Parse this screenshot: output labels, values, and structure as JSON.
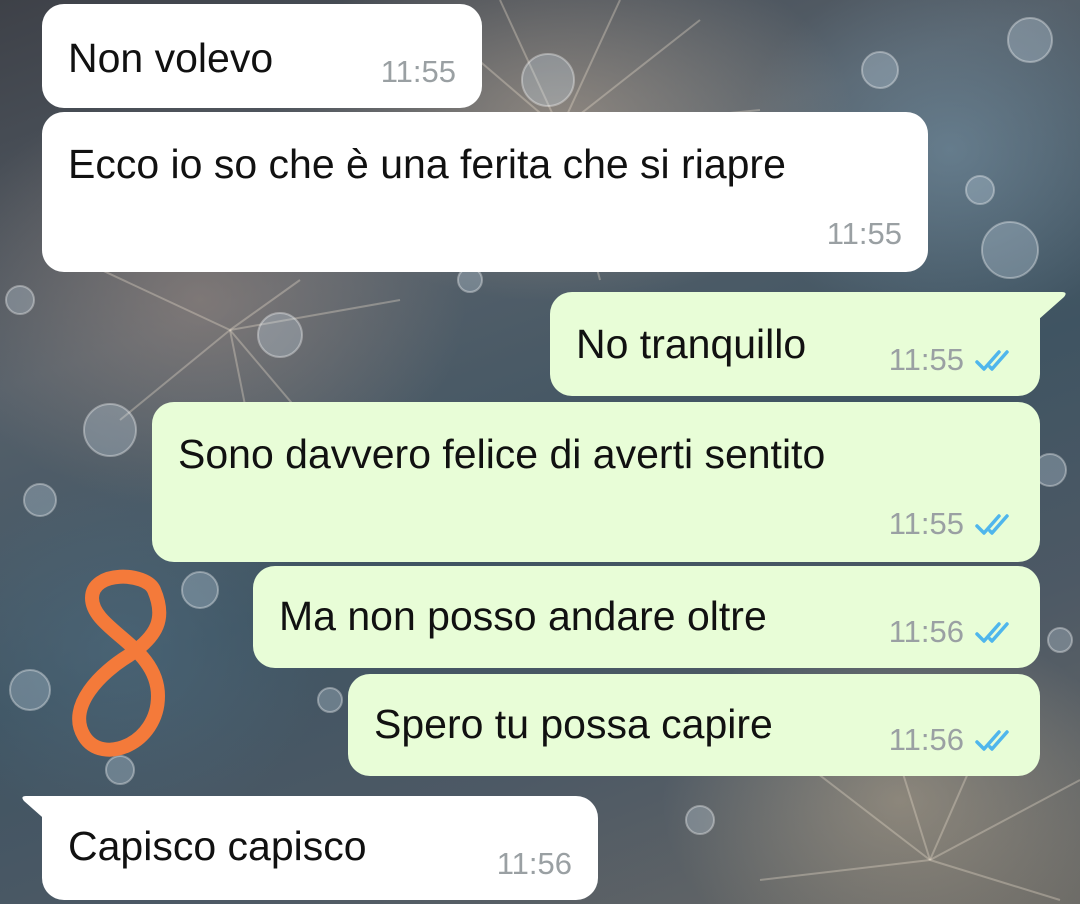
{
  "messages": [
    {
      "side": "incoming",
      "text": "Non volevo",
      "time": "11:55"
    },
    {
      "side": "incoming",
      "text": "Ecco io so che è una ferita che si riapre",
      "time": "11:55"
    },
    {
      "side": "outgoing",
      "text": "No tranquillo",
      "time": "11:55",
      "status": "double-check-read-icon"
    },
    {
      "side": "outgoing",
      "text": "Sono davvero felice di averti sentito",
      "time": "11:55",
      "status": "double-check-read-icon"
    },
    {
      "side": "outgoing",
      "text": "Ma non posso andare oltre",
      "time": "11:56",
      "status": "double-check-read-icon"
    },
    {
      "side": "outgoing",
      "text": "Spero tu possa capire",
      "time": "11:56",
      "status": "double-check-read-icon"
    },
    {
      "side": "incoming",
      "text": "Capisco capisco",
      "time": "11:56"
    }
  ],
  "colors": {
    "incoming_bubble": "#ffffff",
    "outgoing_bubble": "#e8fdd7",
    "timestamp": "#9aa0a3",
    "read_ticks": "#4fb6ec",
    "annotation": "#f47a3a"
  },
  "annotation": {
    "label": "8"
  }
}
